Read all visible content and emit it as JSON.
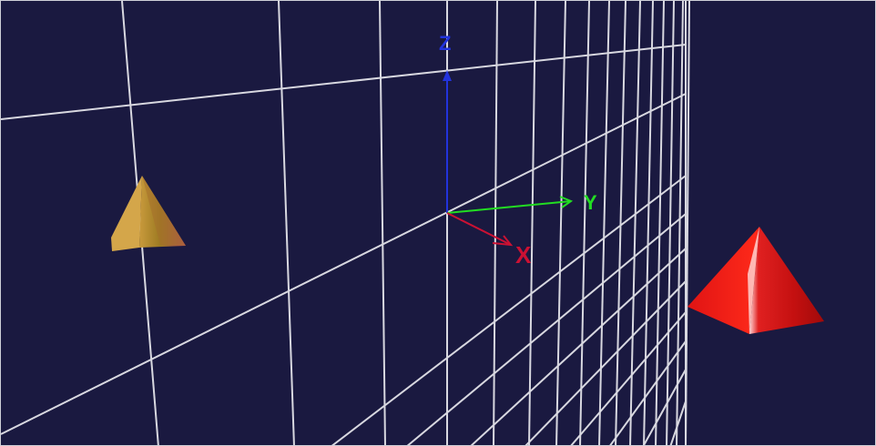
{
  "scene": {
    "background_color": "#1a1940",
    "grid_color": "#d8d8e0",
    "axes": {
      "x": {
        "label": "X",
        "color": "#cc1133"
      },
      "y": {
        "label": "Y",
        "color": "#22dd22"
      },
      "z": {
        "label": "Z",
        "color": "#2233dd"
      }
    },
    "objects": [
      {
        "name": "pyramid-small",
        "color": "#b07a2a"
      },
      {
        "name": "pyramid-large",
        "color": "#e01010"
      }
    ]
  }
}
